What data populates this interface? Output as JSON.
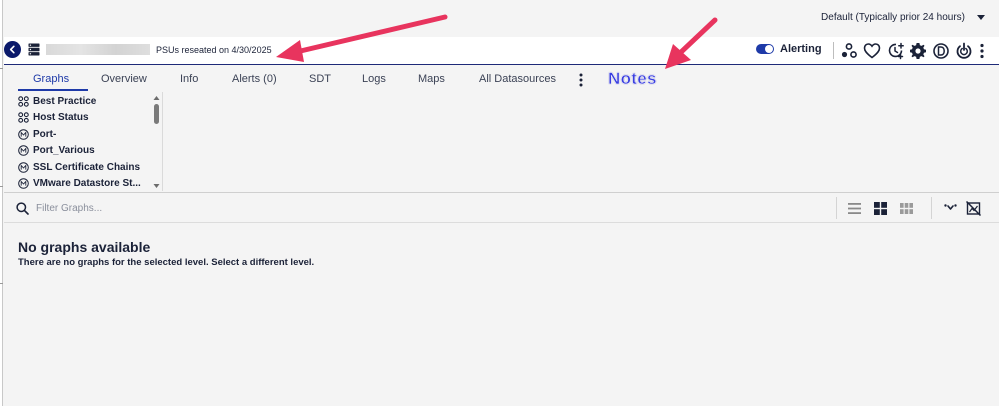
{
  "topbar": {
    "time_range": "Default (Typically prior 24 hours)"
  },
  "header": {
    "device_description": "PSUs reseated on 4/30/2025",
    "alerting_label": "Alerting",
    "icons": [
      "back-icon",
      "device-icon",
      "cluster-icon",
      "heart-icon",
      "schedule-add-icon",
      "gear-icon",
      "d-badge-icon",
      "power-icon",
      "more-vertical-icon"
    ]
  },
  "tabs": {
    "items": [
      "Graphs",
      "Overview",
      "Info",
      "Alerts (0)",
      "SDT",
      "Logs",
      "Maps",
      "All Datasources"
    ],
    "active": "Graphs"
  },
  "annotation": {
    "notes_label": "Notes",
    "arrow_color": "#e8345e"
  },
  "tree": {
    "items": [
      {
        "label": "Best Practice",
        "icon": "group-icon"
      },
      {
        "label": "Host Status",
        "icon": "group-icon"
      },
      {
        "label": "Port-",
        "icon": "m-circle-icon"
      },
      {
        "label": "Port_Various",
        "icon": "m-circle-icon"
      },
      {
        "label": "SSL Certificate Chains",
        "icon": "m-circle-icon"
      },
      {
        "label": "VMware Datastore St...",
        "icon": "m-circle-icon"
      }
    ]
  },
  "filter": {
    "placeholder": "Filter Graphs..."
  },
  "empty_state": {
    "title": "No graphs available",
    "description": "There are no graphs for the selected level. Select a different level."
  },
  "colors": {
    "accent": "#1e3aa8",
    "navy": "#0b1a6b",
    "text": "#1b2238",
    "background": "#f4f4f4"
  }
}
